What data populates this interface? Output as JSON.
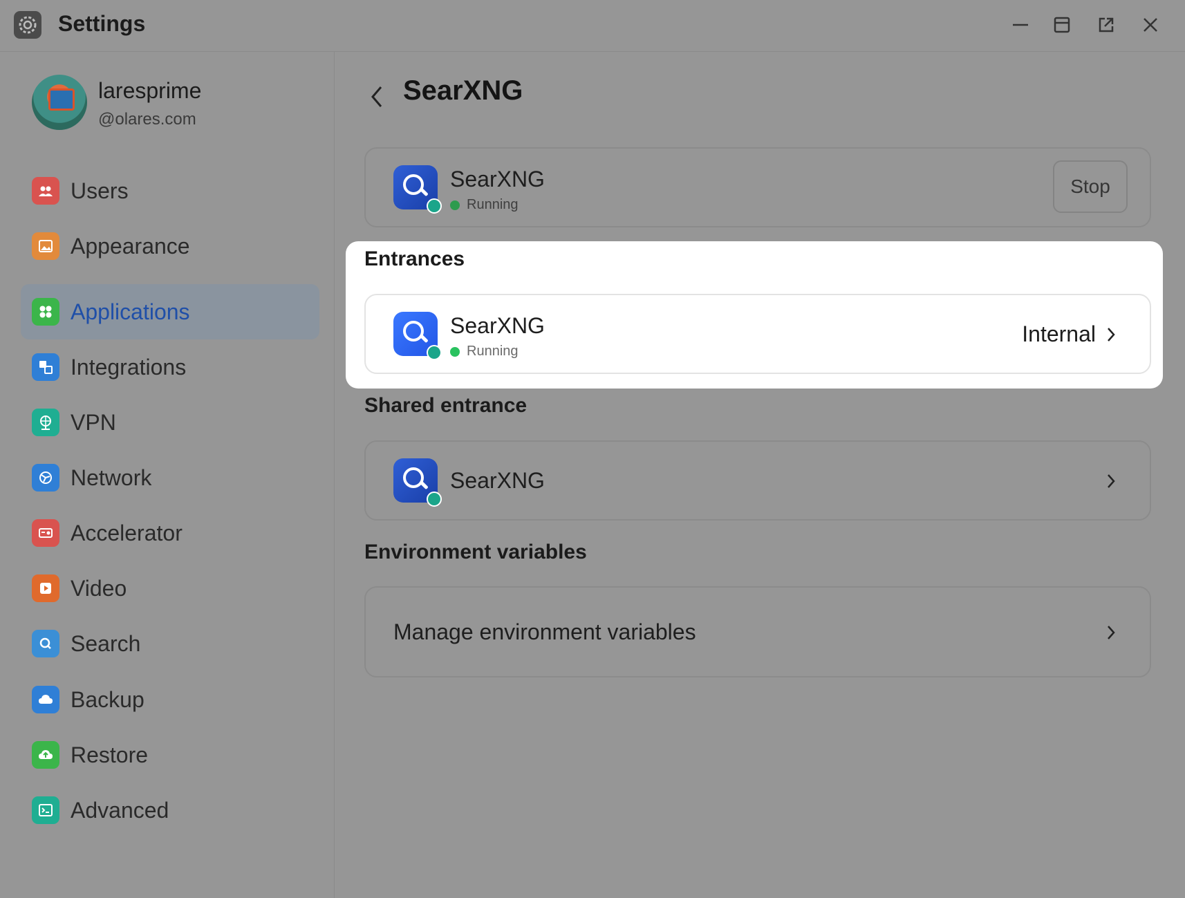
{
  "window": {
    "title": "Settings",
    "controls": [
      "minimize-icon",
      "maximize-icon",
      "open-external-icon",
      "close-icon"
    ]
  },
  "user": {
    "name": "laresprime",
    "domain": "@olares.com"
  },
  "sidebar": {
    "items": [
      {
        "label": "Users",
        "icon": "users-icon",
        "color": "#d9534f"
      },
      {
        "label": "Appearance",
        "icon": "image-icon",
        "color": "#e28a3b"
      },
      {
        "label": "Applications",
        "icon": "apps-icon",
        "color": "#3bb54a",
        "active": true
      },
      {
        "label": "Integrations",
        "icon": "integrations-icon",
        "color": "#2f7fd6"
      },
      {
        "label": "VPN",
        "icon": "vpn-icon",
        "color": "#1fae92"
      },
      {
        "label": "Network",
        "icon": "network-icon",
        "color": "#2f7fd6"
      },
      {
        "label": "Accelerator",
        "icon": "accelerator-icon",
        "color": "#d9534f"
      },
      {
        "label": "Video",
        "icon": "video-icon",
        "color": "#e06a2c"
      },
      {
        "label": "Search",
        "icon": "search-icon",
        "color": "#3b8fd6"
      },
      {
        "label": "Backup",
        "icon": "cloud-backup-icon",
        "color": "#2f7fd6"
      },
      {
        "label": "Restore",
        "icon": "cloud-restore-icon",
        "color": "#3bb54a"
      },
      {
        "label": "Advanced",
        "icon": "terminal-icon",
        "color": "#1fae92"
      }
    ]
  },
  "page": {
    "title": "SearXNG",
    "app_card": {
      "name": "SearXNG",
      "status": "Running",
      "stop_label": "Stop"
    },
    "entrances": {
      "title": "Entrances",
      "item": {
        "name": "SearXNG",
        "status": "Running",
        "access": "Internal"
      }
    },
    "shared_entrance": {
      "title": "Shared entrance",
      "item": {
        "name": "SearXNG"
      }
    },
    "env": {
      "title": "Environment variables",
      "item_label": "Manage environment variables"
    }
  }
}
